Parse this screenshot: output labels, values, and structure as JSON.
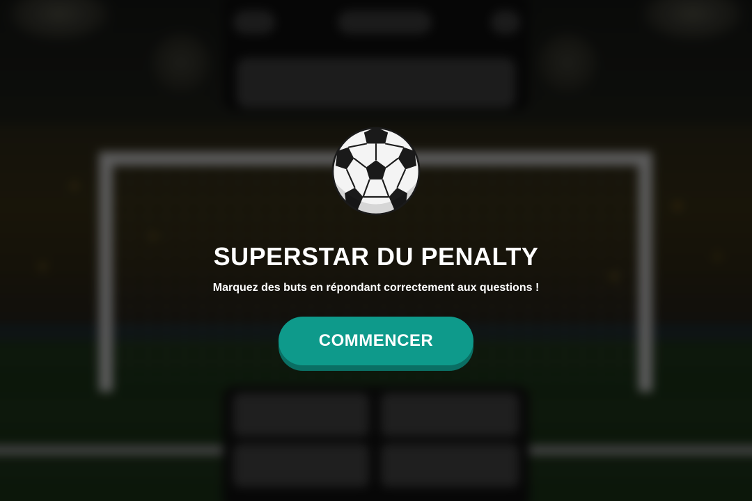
{
  "game": {
    "title": "SUPERSTAR DU PENALTY",
    "subtitle": "Marquez des buts en répondant correctement aux questions !",
    "start_label": "COMMENCER",
    "ball_icon": "soccer-ball-icon"
  },
  "colors": {
    "start_button": "#0e9a8b",
    "start_button_shadow": "#0a6f64",
    "title_text": "#ffffff",
    "overlay_dim": "rgba(0,0,0,0.52)"
  }
}
